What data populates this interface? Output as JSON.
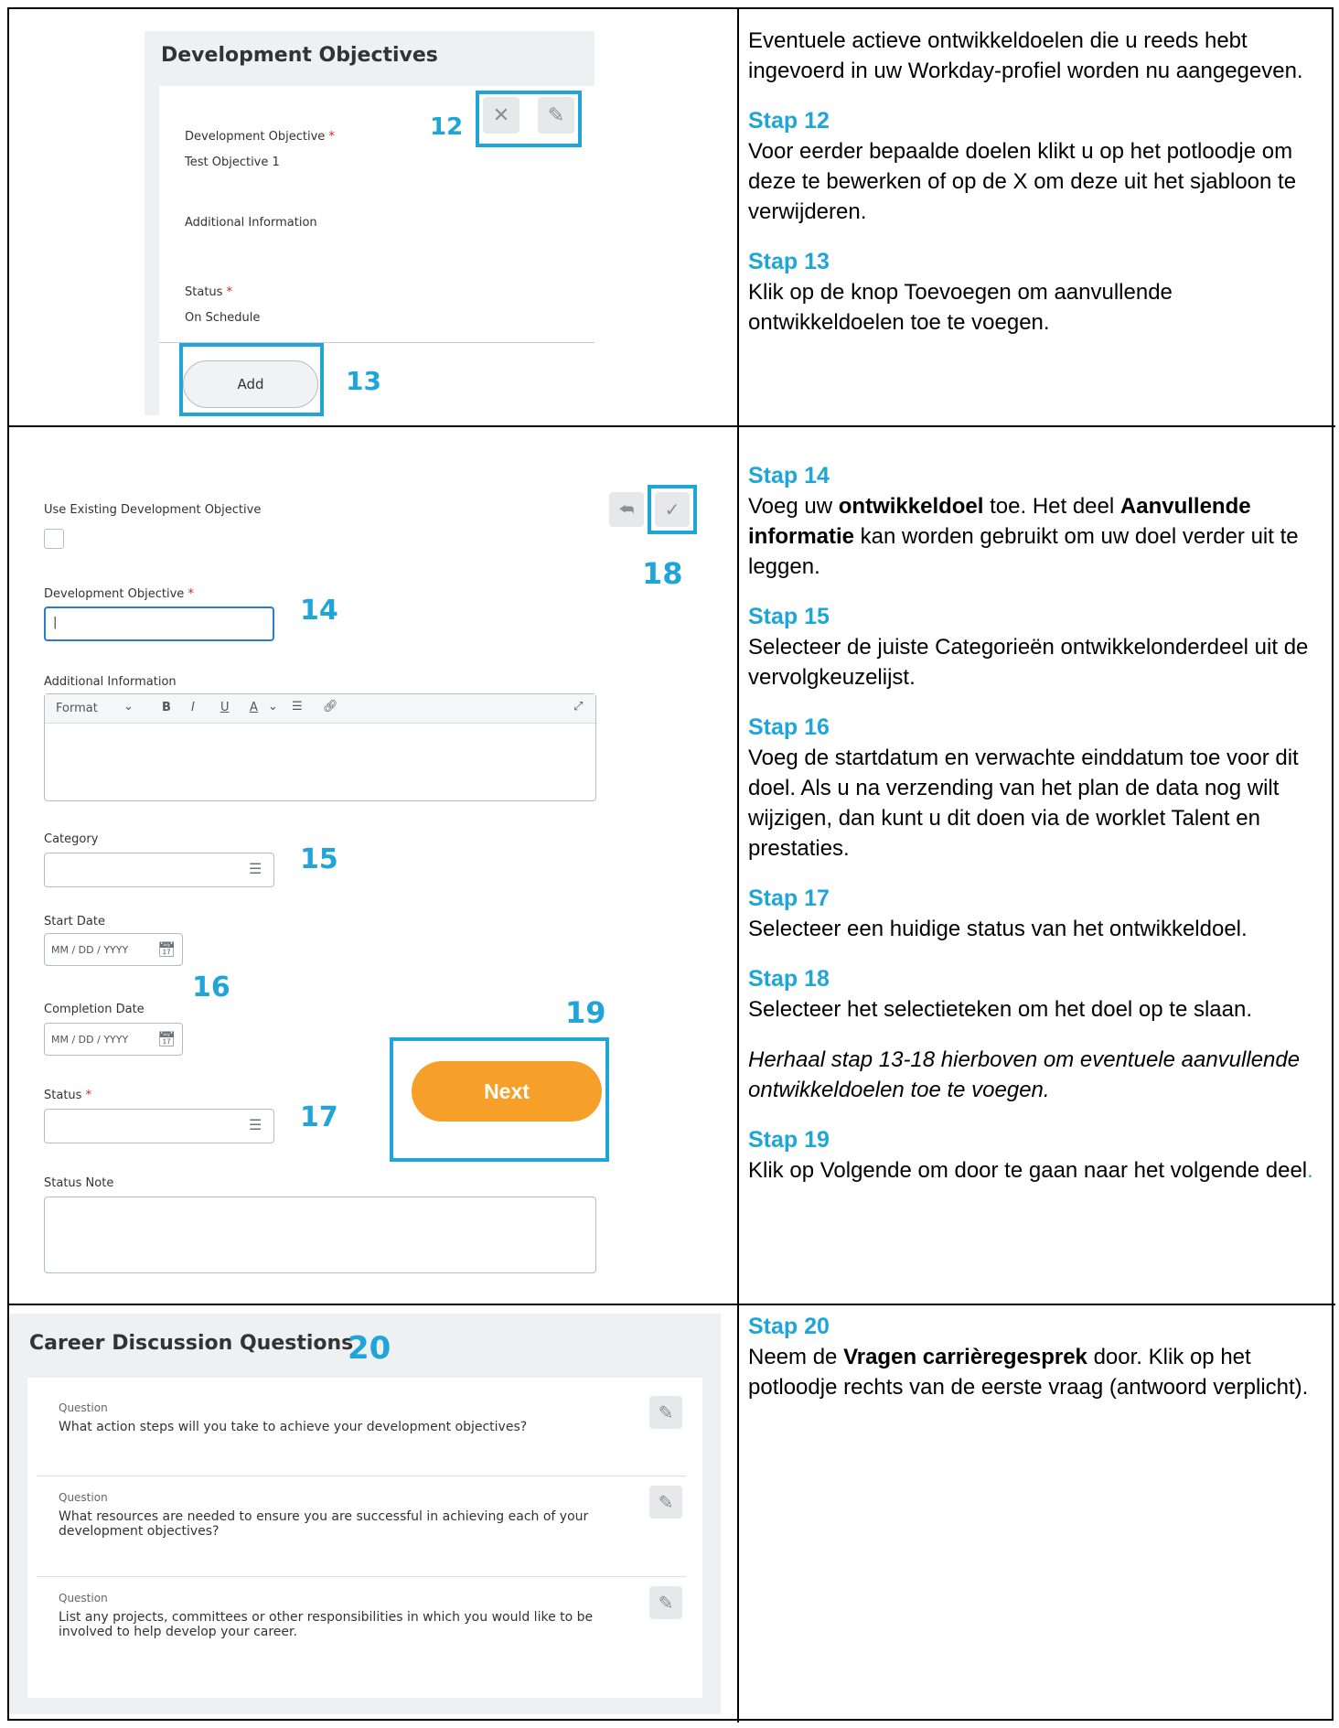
{
  "row1": {
    "panel_title": "Development Objectives",
    "field_label": "Development Objective",
    "field_value": "Test Objective 1",
    "additional_label": "Additional Information",
    "status_label": "Status",
    "status_value": "On Schedule",
    "add_button": "Add",
    "callout_12": "12",
    "callout_13": "13",
    "instructions": {
      "intro": "Eventuele actieve ontwikkeldoelen die u reeds hebt ingevoerd in uw Workday-profiel worden nu aangegeven.",
      "step12_title": "Stap 12",
      "step12_text": "Voor eerder bepaalde doelen klikt u op het potloodje om deze te bewerken of op de X om deze uit het sjabloon te verwijderen.",
      "step13_title": "Stap 13",
      "step13_text": "Klik op de knop Toevoegen om aanvullende ontwikkeldoelen toe te voegen."
    }
  },
  "row2": {
    "use_existing_label": "Use Existing Development Objective",
    "dev_objective_label": "Development Objective",
    "dev_objective_value": "|",
    "additional_label": "Additional Information",
    "toolbar": {
      "format": "Format",
      "bold": "B",
      "italic": "I",
      "underline": "U",
      "color": "A"
    },
    "category_label": "Category",
    "start_date_label": "Start Date",
    "start_date_placeholder": "MM / DD / YYYY",
    "completion_date_label": "Completion Date",
    "completion_date_placeholder": "MM / DD / YYYY",
    "status_label": "Status",
    "status_note_label": "Status Note",
    "next_button": "Next",
    "callouts": {
      "c14": "14",
      "c15": "15",
      "c16": "16",
      "c17": "17",
      "c18": "18",
      "c19": "19"
    },
    "instructions": {
      "step14_title": "Stap 14",
      "step14_pre": "Voeg uw ",
      "step14_bold1": "ontwikkeldoel",
      "step14_mid": " toe. Het deel ",
      "step14_bold2": "Aanvullende informatie",
      "step14_post": " kan worden gebruikt om uw doel verder uit te leggen.",
      "step15_title": "Stap 15",
      "step15_text": "Selecteer de juiste Categorieën ontwikkelonderdeel uit de vervolgkeuzelijst.",
      "step16_title": "Stap 16",
      "step16_text": "Voeg de startdatum en verwachte einddatum toe voor dit doel. Als u na verzending van het plan de data nog wilt wijzigen, dan kunt u dit doen via de worklet Talent en prestaties.",
      "step17_title": "Stap 17",
      "step17_text": "Selecteer een huidige status van het ontwikkeldoel.",
      "step18_title": "Stap 18",
      "step18_text": "Selecteer het selectieteken om het doel op te slaan.",
      "repeat_note": "Herhaal stap 13-18 hierboven om eventuele aanvullende ontwikkeldoelen toe te voegen.",
      "step19_title": "Stap 19",
      "step19_text": "Klik op Volgende om door te gaan naar het volgende deel",
      "step19_period": "."
    }
  },
  "row3": {
    "panel_title": "Career Discussion Questions",
    "callout_20": "20",
    "questions": [
      {
        "label": "Question",
        "text": "What action steps will you take to achieve your development objectives?"
      },
      {
        "label": "Question",
        "text": "What resources are needed to ensure you are successful in achieving each of your development objectives?"
      },
      {
        "label": "Question",
        "text": "List any projects, committees or other responsibilities in which you would like to be involved to help develop your career."
      }
    ],
    "instructions": {
      "step20_title": "Stap 20",
      "step20_pre": "Neem de ",
      "step20_bold": "Vragen carrièregesprek",
      "step20_post": " door. Klik op het potloodje rechts van de eerste vraag (antwoord verplicht)."
    }
  },
  "colors": {
    "accent": "#1fa5d8",
    "next_button": "#f6a02a",
    "required": "#e02020"
  }
}
